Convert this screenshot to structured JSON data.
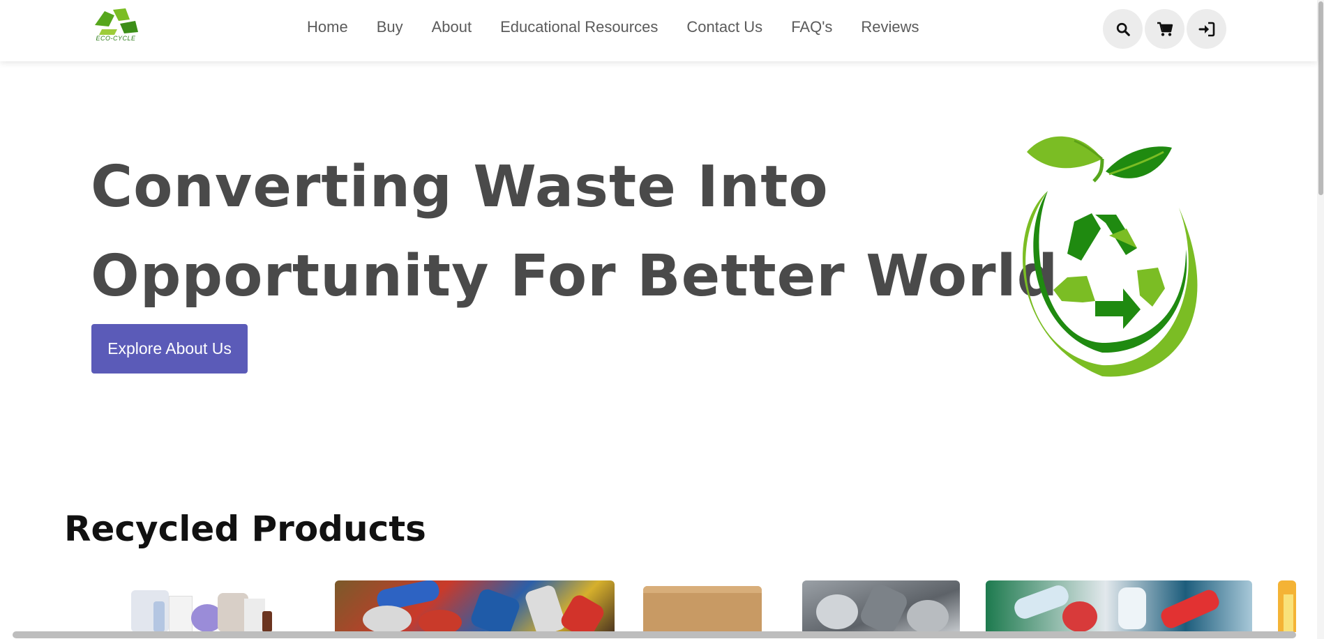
{
  "brand": {
    "name": "ECO-CYCLE"
  },
  "nav": {
    "items": [
      "Home",
      "Buy",
      "About",
      "Educational Resources",
      "Contact Us",
      "FAQ's",
      "Reviews"
    ]
  },
  "actions": {
    "search": "search-icon",
    "cart": "cart-icon",
    "login": "sign-in-icon"
  },
  "hero": {
    "line1": "Converting Waste Into",
    "line2": "Opportunity For Better World.",
    "cta": "Explore About Us"
  },
  "products": {
    "title": "Recycled Products",
    "items": [
      "mixed-recyclables",
      "aluminum-cans",
      "cardboard-box",
      "metal-scrap",
      "plastic-bottles",
      "partial-item"
    ]
  },
  "colors": {
    "accent": "#5b5bb8",
    "leaf_light": "#84bb1c",
    "leaf_dark": "#1f8a10"
  }
}
